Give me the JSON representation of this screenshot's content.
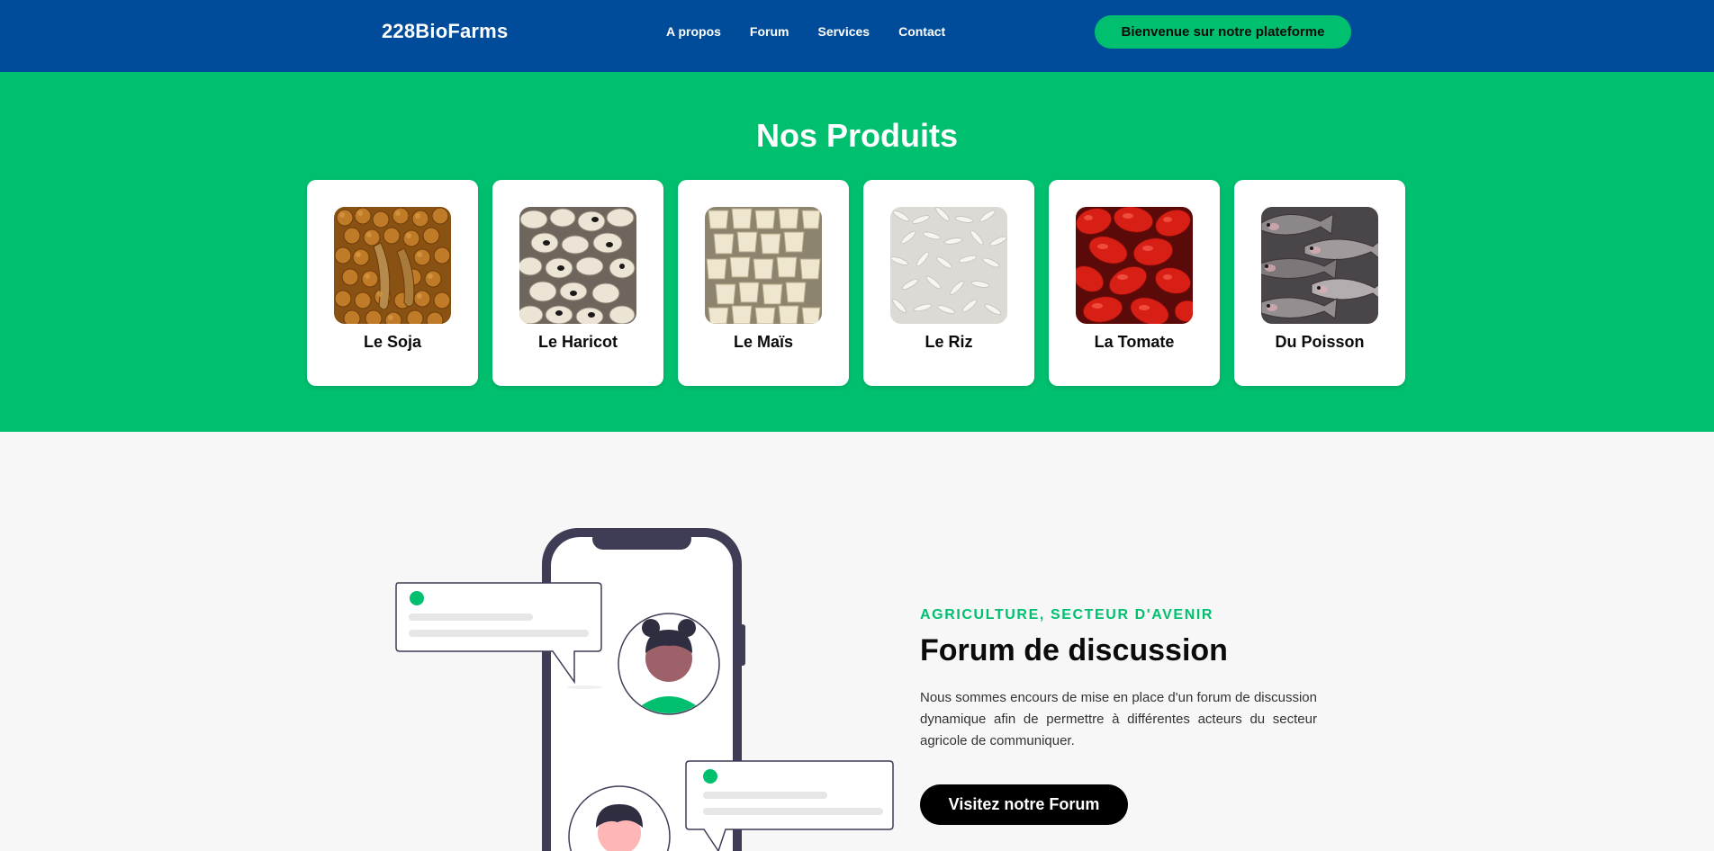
{
  "navbar": {
    "brand": "228BioFarms",
    "links": [
      "A propos",
      "Forum",
      "Services",
      "Contact"
    ],
    "cta_label": "Bienvenue sur notre plateforme"
  },
  "products": {
    "title": "Nos Produits",
    "items": [
      {
        "label": "Le Soja",
        "image": "soybeans-photo"
      },
      {
        "label": "Le Haricot",
        "image": "beans-photo"
      },
      {
        "label": "Le Maïs",
        "image": "maize-photo"
      },
      {
        "label": "Le Riz",
        "image": "rice-photo"
      },
      {
        "label": "La Tomate",
        "image": "tomatoes-photo"
      },
      {
        "label": "Du Poisson",
        "image": "fish-photo"
      }
    ]
  },
  "forum": {
    "kicker": "AGRICULTURE, SECTEUR D'AVENIR",
    "title": "Forum de discussion",
    "description": "Nous sommes encours de mise en place d'un forum de discussion dynamique afin de permettre à différentes acteurs du secteur agricole de communiquer.",
    "button_label": "Visitez notre Forum",
    "illustration": "phone-chat-illustration"
  },
  "colors": {
    "navbar": "#004c9b",
    "accent_green": "#00c06f",
    "card_bg": "#ffffff",
    "section_bg": "#f7f7f7",
    "button_dark": "#000000"
  }
}
